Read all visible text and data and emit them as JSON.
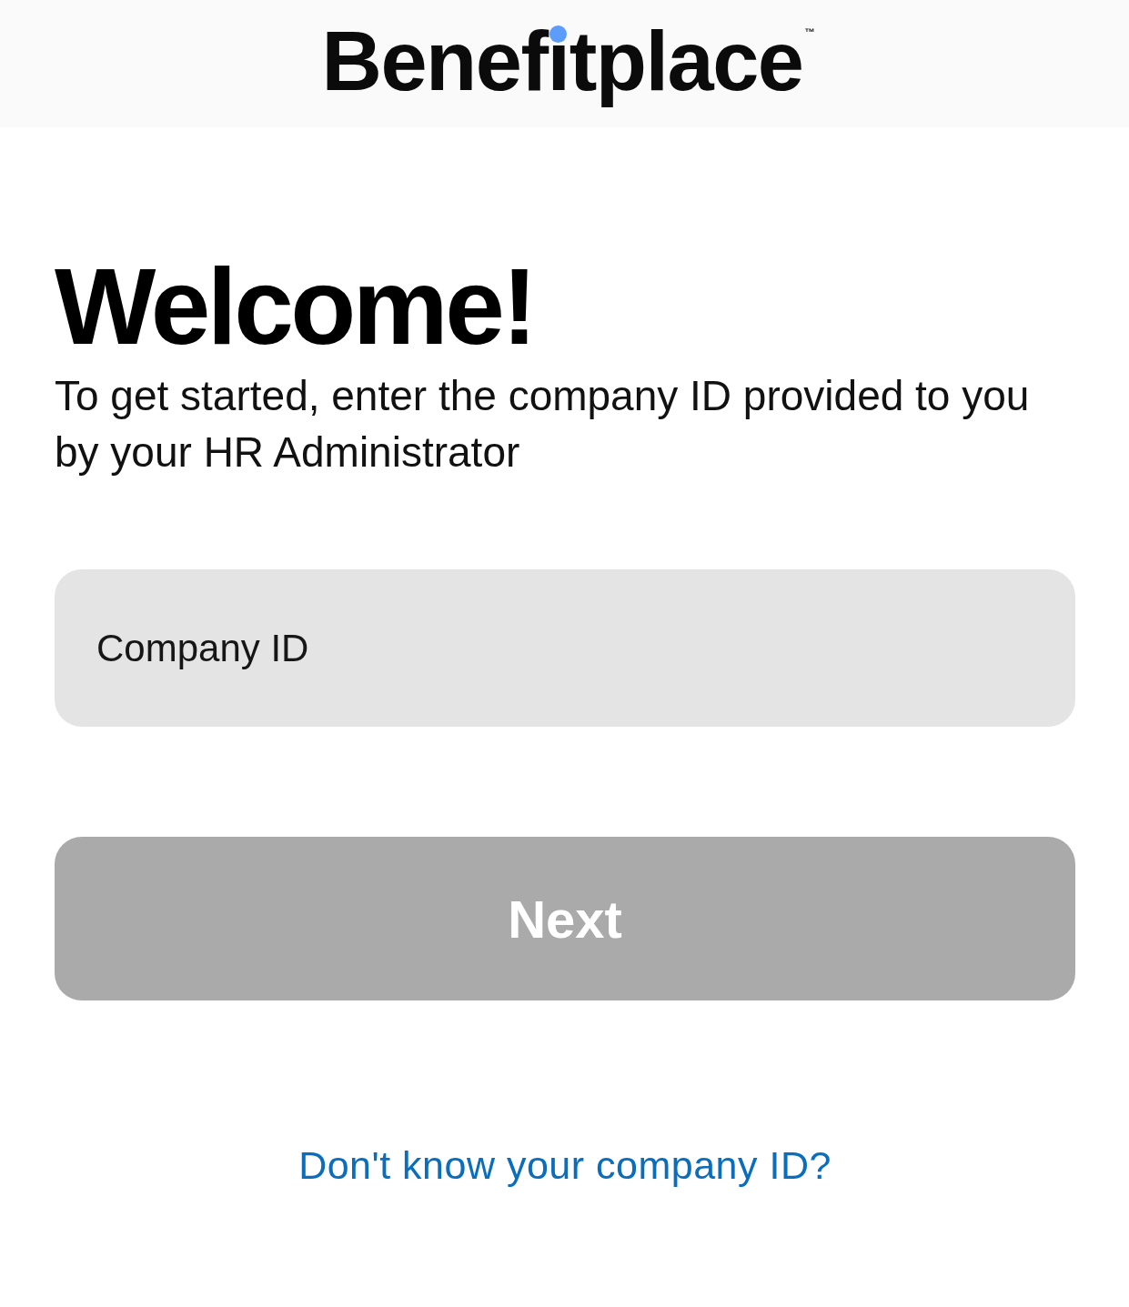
{
  "logo": {
    "name": "Benefitplace",
    "trademark": "™"
  },
  "heading": "Welcome!",
  "intro": "To get started, enter the company ID provided to you by your HR Administrator",
  "company_id_field": {
    "placeholder": "Company ID"
  },
  "next_button": {
    "label": "Next",
    "disabled": true
  },
  "help_link": "Don't know your company ID?"
}
